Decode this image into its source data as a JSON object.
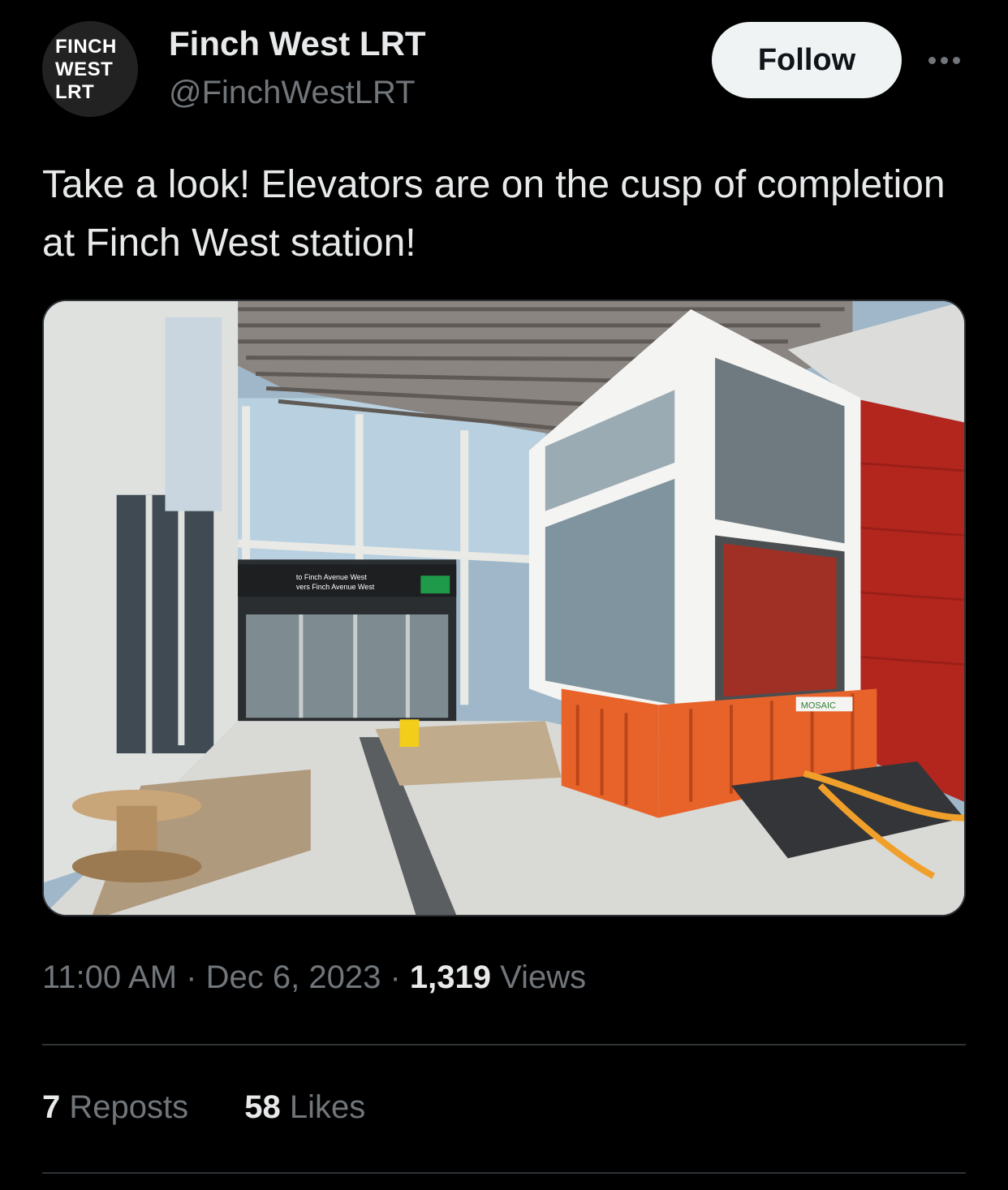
{
  "account": {
    "avatar_lines": [
      "FINCH",
      "WEST",
      "LRT"
    ],
    "display_name": "Finch West LRT",
    "handle": "@FinchWestLRT"
  },
  "actions": {
    "follow_label": "Follow"
  },
  "tweet": {
    "text": "Take a look! Elevators are on the cusp of completion at Finch West station!",
    "image_sign_text_1": "to Finch Avenue West",
    "image_sign_text_2": "vers Finch Avenue West",
    "barrier_brand": "MOSAIC"
  },
  "meta": {
    "time": "11:00 AM",
    "separator": "·",
    "date": "Dec 6, 2023",
    "views_count": "1,319",
    "views_label": "Views"
  },
  "stats": {
    "reposts_count": "7",
    "reposts_label": "Reposts",
    "likes_count": "58",
    "likes_label": "Likes"
  },
  "colors": {
    "background": "#000000",
    "primary_text": "#e7e9ea",
    "secondary_text": "#71767b",
    "follow_bg": "#eff3f4",
    "divider": "#2f3336",
    "barrier_orange": "#e8632a",
    "wall_red": "#b3261e"
  },
  "icons": {
    "more": "more-horizontal-icon"
  }
}
